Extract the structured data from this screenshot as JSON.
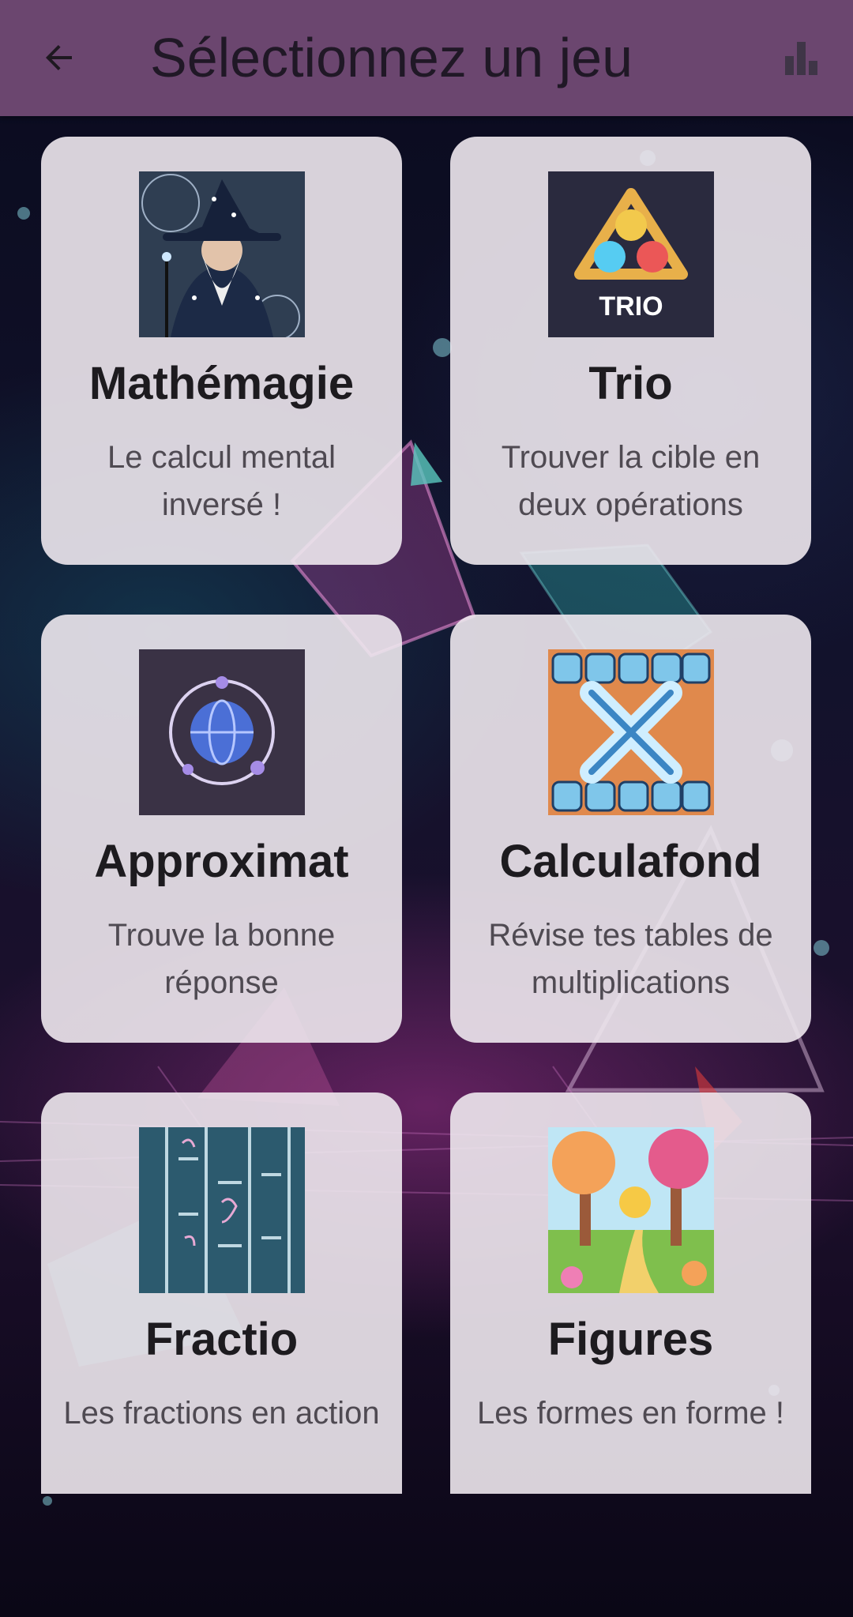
{
  "app_bar": {
    "title": "Sélectionnez un jeu",
    "back_icon": "arrow-back-icon",
    "stats_icon": "bar-chart-icon",
    "background": "#6b466f"
  },
  "games": [
    {
      "title": "Mathémagie",
      "subtitle": "Le calcul mental inversé !",
      "image": "wizard-image"
    },
    {
      "title": "Trio",
      "subtitle": "Trouver la cible en deux opérations",
      "image": "trio-logo-image",
      "image_text": "TRIO"
    },
    {
      "title": "Approximat",
      "subtitle": "Trouve la bonne réponse",
      "image": "globe-orbit-image"
    },
    {
      "title": "Calculafond",
      "subtitle": "Révise tes tables de multiplications",
      "image": "number-tiles-image"
    },
    {
      "title": "Fractio",
      "subtitle": "Les fractions en action",
      "image": "chalkboard-fractions-image"
    },
    {
      "title": "Figures",
      "subtitle": "Les formes en forme !",
      "image": "candy-forest-image"
    }
  ]
}
